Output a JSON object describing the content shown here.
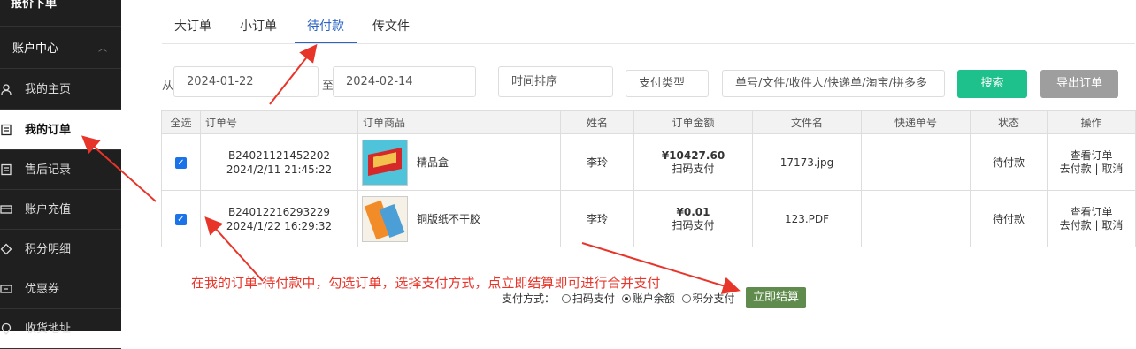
{
  "sidebar": {
    "top_label": "报价下单",
    "section_title": "账户中心",
    "items": [
      {
        "label": "我的主页",
        "icon": "user-icon"
      },
      {
        "label": "我的订单",
        "icon": "order-icon",
        "active": true
      },
      {
        "label": "售后记录",
        "icon": "record-icon"
      },
      {
        "label": "账户充值",
        "icon": "card-icon"
      },
      {
        "label": "积分明细",
        "icon": "diamond-icon"
      },
      {
        "label": "优惠券",
        "icon": "coupon-icon"
      },
      {
        "label": "收货地址",
        "icon": "address-icon"
      }
    ]
  },
  "tabs": [
    "大订单",
    "小订单",
    "待付款",
    "传文件"
  ],
  "active_tab": "待付款",
  "filters": {
    "from_label": "从",
    "to_label": "至",
    "date_from": "2024-01-22",
    "date_to": "2024-02-14",
    "sort_placeholder": "时间排序",
    "pay_type_placeholder": "支付类型",
    "keyword_placeholder": "单号/文件/收件人/快递单/淘宝/拼多多",
    "search_label": "搜索",
    "export_label": "导出订单"
  },
  "table": {
    "headers": [
      "全选",
      "订单号",
      "订单商品",
      "姓名",
      "订单金额",
      "文件名",
      "快递单号",
      "状态",
      "操作"
    ],
    "rows": [
      {
        "order_no": "B24021121452202",
        "time": "2024/2/11 21:45:22",
        "product": "精品盒",
        "name": "李玲",
        "amount": "¥10427.60",
        "pay": "扫码支付",
        "file": "17173.jpg",
        "express": "",
        "status": "待付款",
        "op1": "查看订单",
        "op2": "去付款",
        "op3": "取消"
      },
      {
        "order_no": "B24012216293229",
        "time": "2024/1/22 16:29:32",
        "product": "铜版纸不干胶",
        "name": "李玲",
        "amount": "¥0.01",
        "pay": "扫码支付",
        "file": "123.PDF",
        "express": "",
        "status": "待付款",
        "op1": "查看订单",
        "op2": "去付款",
        "op3": "取消"
      }
    ]
  },
  "annotation": "在我的订单-待付款中，勾选订单，选择支付方式，点立即结算即可进行合并支付",
  "payment": {
    "label": "支付方式：",
    "options": [
      "扫码支付",
      "账户余额",
      "积分支付"
    ],
    "selected": "账户余额",
    "settle_label": "立即结算",
    "separator": "|"
  },
  "colors": {
    "sidebar_bg": "#1f1f1f",
    "tab_active": "#2b64c3",
    "search_btn": "#1ec08b",
    "export_btn": "#9e9e9e",
    "settle_btn": "#5f8b4c",
    "annotation": "#e8352a"
  }
}
